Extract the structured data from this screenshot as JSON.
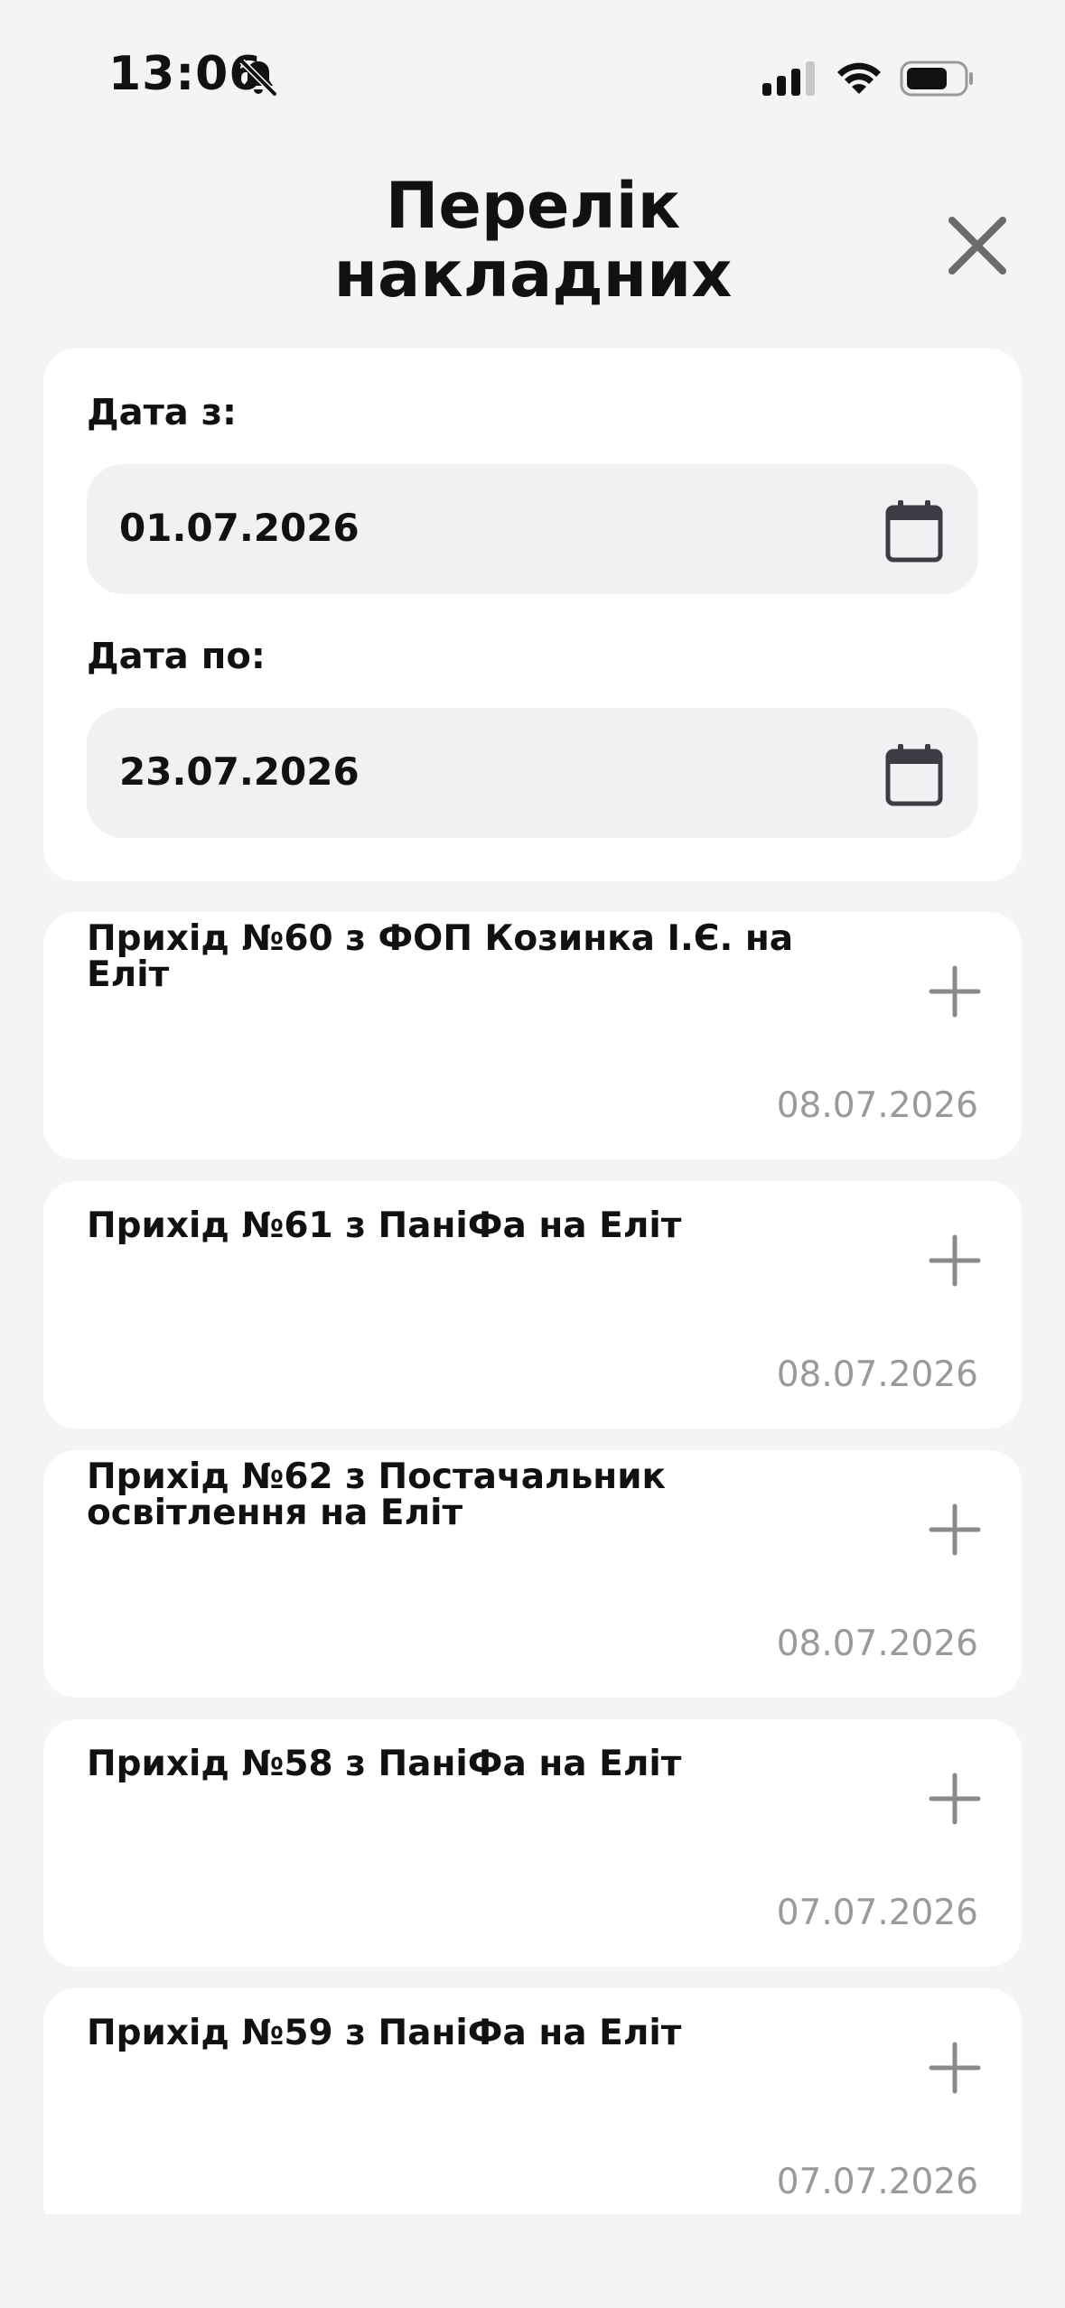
{
  "status_bar": {
    "time": "13:06",
    "mute_icon": "bell-slash-icon",
    "signal_icon": "cellular-signal-icon",
    "wifi_icon": "wifi-icon",
    "battery_icon": "battery-icon"
  },
  "header": {
    "title": "Перелік\nнакладних",
    "close_icon": "close-icon"
  },
  "filters": {
    "date_from_label": "Дата з:",
    "date_from_value": "01.07.2026",
    "date_to_label": "Дата по:",
    "date_to_value": "23.07.2026",
    "calendar_icon": "calendar-icon"
  },
  "invoices": [
    {
      "title": "Прихід №60 з ФОП Козинка І.Є. на Еліт",
      "date": "08.07.2026"
    },
    {
      "title": "Прихід №61 з ПаніФа на Еліт",
      "date": "08.07.2026"
    },
    {
      "title": "Прихід №62 з Постачальник освітлення на Еліт",
      "date": "08.07.2026"
    },
    {
      "title": "Прихід №58 з ПаніФа на Еліт",
      "date": "07.07.2026"
    },
    {
      "title": "Прихід №59 з ПаніФа на Еліт",
      "date": "07.07.2026"
    }
  ],
  "colors": {
    "background": "#f4f4f5",
    "card": "#ffffff",
    "field": "#f1f1f3",
    "muted_text": "#9a9a9a",
    "icon_gray": "#8a8a8a"
  }
}
